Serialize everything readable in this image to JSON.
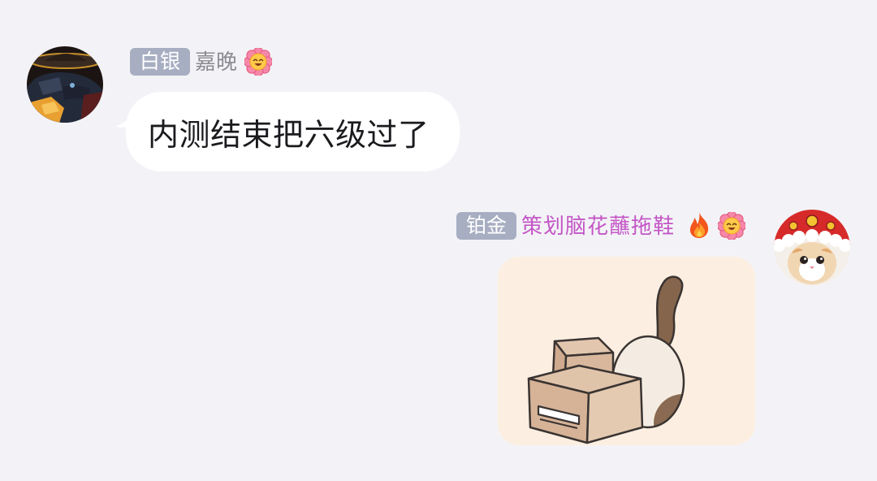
{
  "chat": {
    "messages": [
      {
        "side": "left",
        "sender": {
          "badge": "白银",
          "name": "嘉晚",
          "avatar": "dark-character-avatar",
          "icons": [
            "flower-smile-icon"
          ]
        },
        "text": "内测结束把六级过了"
      },
      {
        "side": "right",
        "sender": {
          "badge": "铂金",
          "name": "策划脑花蘸拖鞋",
          "avatar": "cat-red-hat-avatar",
          "icons": [
            "fire-icon",
            "flower-smile-icon"
          ]
        },
        "sticker": "cat-hiding-in-boxes-sticker"
      }
    ]
  },
  "colors": {
    "background": "#f3f3f7",
    "badge": "#a7aec2",
    "left_name": "#8b8b91",
    "right_name": "#c456c6",
    "bubble": "#ffffff",
    "sticker_background": "#fcefe1"
  }
}
